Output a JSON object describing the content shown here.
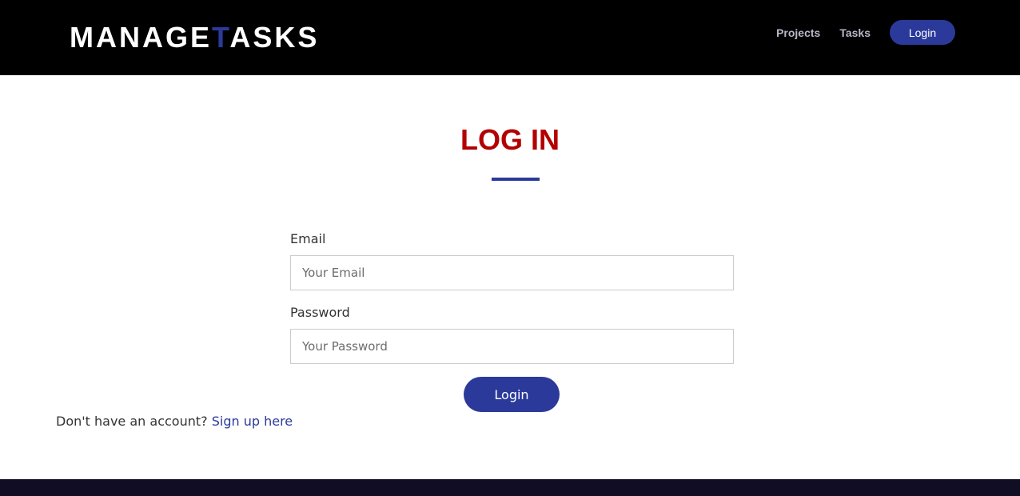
{
  "header": {
    "logo_before": "MANAGE",
    "logo_accent": "T",
    "logo_after": "ASKS",
    "nav": {
      "projects": "Projects",
      "tasks": "Tasks",
      "login": "Login"
    }
  },
  "main": {
    "title": "LOG IN",
    "email_label": "Email",
    "email_placeholder": "Your Email",
    "email_value": "",
    "password_label": "Password",
    "password_placeholder": "Your Password",
    "password_value": "",
    "submit_label": "Login",
    "signup_prompt": "Don't have an account?",
    "signup_link": "Sign up here"
  },
  "colors": {
    "brand_blue": "#2b3a9a",
    "title_red": "#b30000",
    "header_bg": "#000000",
    "footer_bg": "#110d24"
  }
}
